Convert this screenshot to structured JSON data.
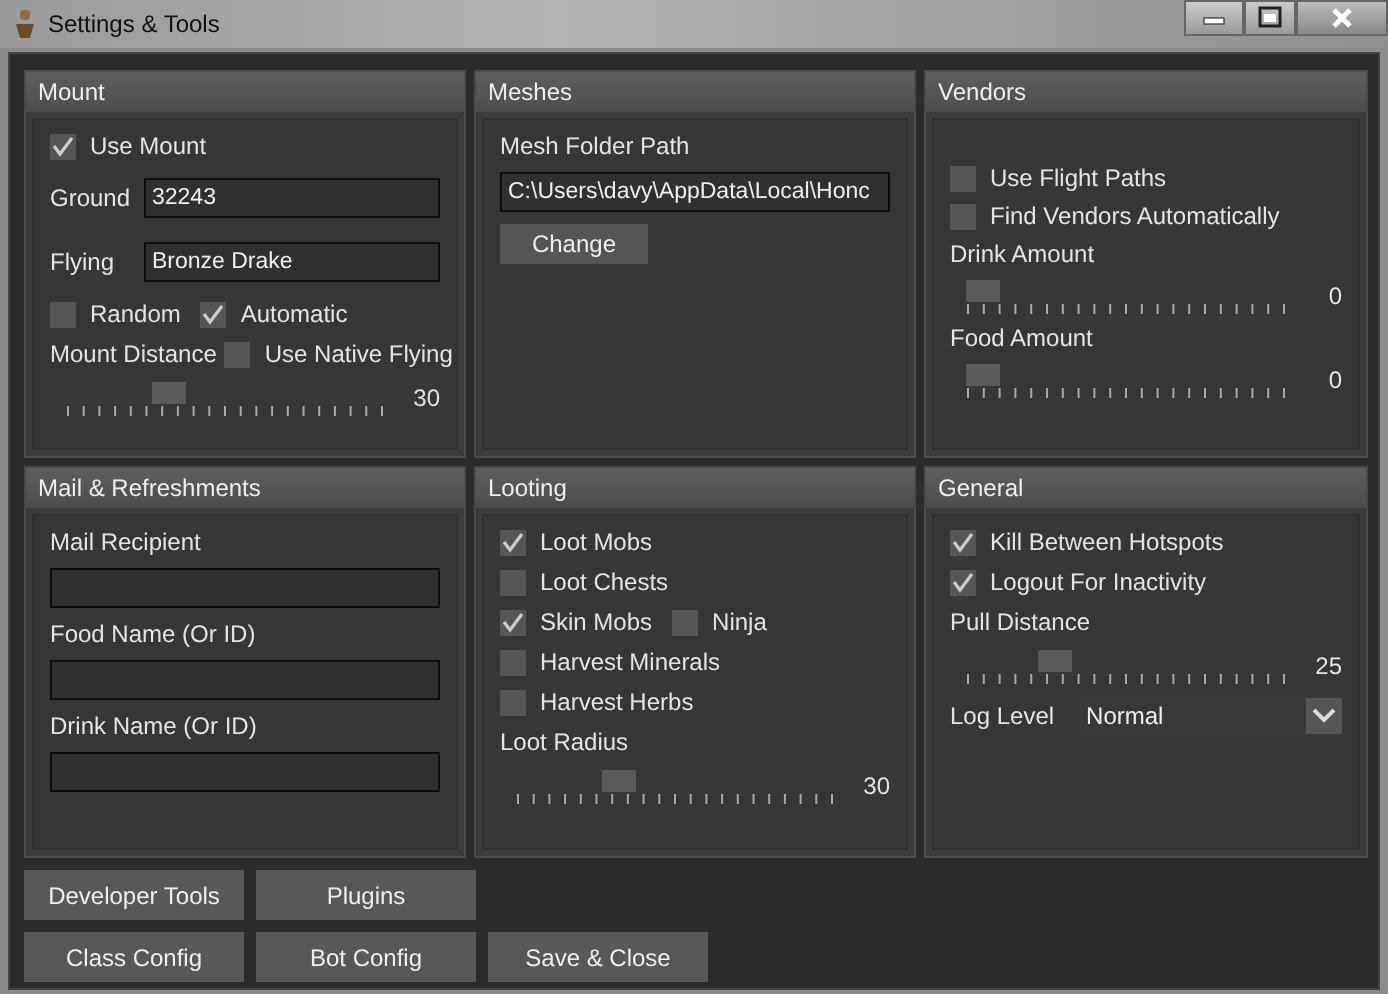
{
  "window": {
    "title": "Settings & Tools"
  },
  "panels": [
    {
      "title": "Mount",
      "items": [
        {
          "kind": "check",
          "label": "Use Mount",
          "checked": true
        },
        {
          "kind": "labeled-field",
          "label": "Ground",
          "value": "32243"
        },
        {
          "kind": "labeled-field",
          "label": "Flying",
          "value": "Bronze Drake"
        },
        {
          "kind": "row",
          "items": [
            {
              "kind": "check",
              "label": "Random",
              "checked": false
            },
            {
              "kind": "check",
              "label": "Automatic",
              "checked": true
            }
          ]
        },
        {
          "kind": "row",
          "items": [
            {
              "kind": "text",
              "text": "Mount Distance"
            },
            {
              "kind": "check",
              "label": "Use Native Flying",
              "checked": false
            }
          ]
        },
        {
          "kind": "slider",
          "level": 0.3,
          "reading": "30"
        }
      ]
    },
    {
      "title": "Meshes",
      "items": [
        {
          "kind": "text",
          "text": "Mesh Folder Path"
        },
        {
          "kind": "field",
          "value": "C:\\Users\\davy\\AppData\\Local\\Honc"
        },
        {
          "kind": "button",
          "label": "Change"
        }
      ]
    },
    {
      "title": "Vendors",
      "items": [
        {
          "kind": "check",
          "label": "Use Flight Paths",
          "checked": false
        },
        {
          "kind": "check",
          "label": "Find Vendors Automatically",
          "checked": false
        },
        {
          "kind": "text",
          "text": "Drink Amount"
        },
        {
          "kind": "slider",
          "level": 0,
          "reading": "0"
        },
        {
          "kind": "text",
          "text": "Food Amount"
        },
        {
          "kind": "slider",
          "level": 0,
          "reading": "0"
        }
      ]
    },
    {
      "title": "Mail & Refreshments",
      "items": [
        {
          "kind": "text",
          "text": "Mail Recipient"
        },
        {
          "kind": "field"
        },
        {
          "kind": "text",
          "text": "Food Name (Or ID)"
        },
        {
          "kind": "field"
        },
        {
          "kind": "text",
          "text": "Drink Name (Or ID)"
        },
        {
          "kind": "field"
        }
      ]
    },
    {
      "title": "Looting",
      "items": [
        {
          "kind": "check",
          "label": "Loot Mobs",
          "checked": true
        },
        {
          "kind": "check",
          "label": "Loot Chests",
          "checked": false
        },
        {
          "kind": "row",
          "items": [
            {
              "kind": "check",
              "label": "Skin Mobs",
              "checked": true
            },
            {
              "kind": "check",
              "label": "Ninja",
              "checked": false
            }
          ]
        },
        {
          "kind": "check",
          "label": "Harvest Minerals",
          "checked": false
        },
        {
          "kind": "check",
          "label": "Harvest Herbs",
          "checked": false
        },
        {
          "kind": "text",
          "text": "Loot Radius"
        },
        {
          "kind": "slider",
          "level": 0.3,
          "reading": "30"
        }
      ]
    },
    {
      "title": "General",
      "items": [
        {
          "kind": "check",
          "label": "Kill Between Hotspots",
          "checked": true
        },
        {
          "kind": "check",
          "label": "Logout For Inactivity",
          "checked": true
        },
        {
          "kind": "text",
          "text": "Pull Distance"
        },
        {
          "kind": "slider",
          "level": 0.25,
          "reading": "25"
        },
        {
          "kind": "select",
          "label": "Log Level",
          "value": "Normal"
        }
      ]
    }
  ],
  "button_rows": [
    [
      "Developer Tools",
      "Plugins"
    ],
    [
      "Class Config",
      "Bot Config",
      "Save & Close"
    ]
  ]
}
